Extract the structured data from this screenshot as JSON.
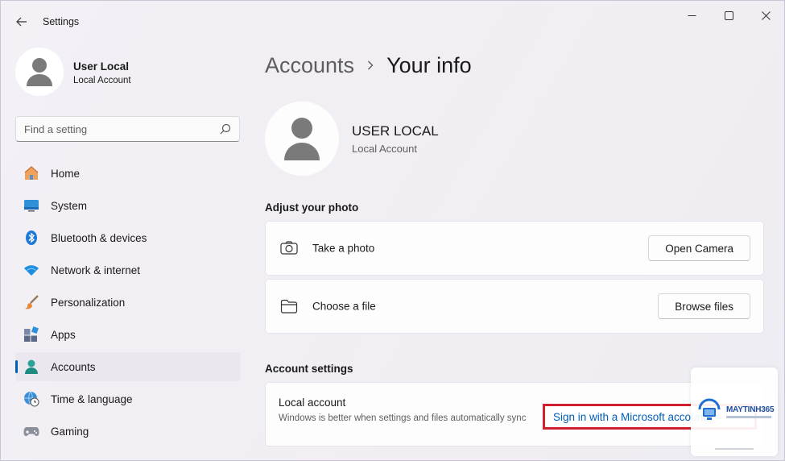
{
  "window": {
    "title": "Settings"
  },
  "profile": {
    "name": "User Local",
    "account_type": "Local Account"
  },
  "search": {
    "placeholder": "Find a setting"
  },
  "sidebar": {
    "items": [
      {
        "label": "Home",
        "icon": "home-icon"
      },
      {
        "label": "System",
        "icon": "system-icon"
      },
      {
        "label": "Bluetooth & devices",
        "icon": "bluetooth-icon"
      },
      {
        "label": "Network & internet",
        "icon": "wifi-icon"
      },
      {
        "label": "Personalization",
        "icon": "brush-icon"
      },
      {
        "label": "Apps",
        "icon": "apps-icon"
      },
      {
        "label": "Accounts",
        "icon": "person-icon",
        "active": true
      },
      {
        "label": "Time & language",
        "icon": "globe-clock-icon"
      },
      {
        "label": "Gaming",
        "icon": "gamepad-icon"
      }
    ]
  },
  "breadcrumb": {
    "parent": "Accounts",
    "current": "Your info"
  },
  "user": {
    "name": "USER LOCAL",
    "account_type": "Local Account"
  },
  "adjust_photo": {
    "title": "Adjust your photo",
    "take_photo": {
      "label": "Take a photo",
      "button": "Open Camera"
    },
    "choose_file": {
      "label": "Choose a file",
      "button": "Browse files"
    }
  },
  "account_settings": {
    "title": "Account settings",
    "local_account_title": "Local account",
    "local_account_desc": "Windows is better when settings and files automatically sync",
    "sign_in_button": "Sign in with a Microsoft account"
  },
  "watermark": {
    "brand": "MAYTINH365"
  },
  "colors": {
    "accent": "#005fb8",
    "highlight_border": "#d0202f"
  }
}
